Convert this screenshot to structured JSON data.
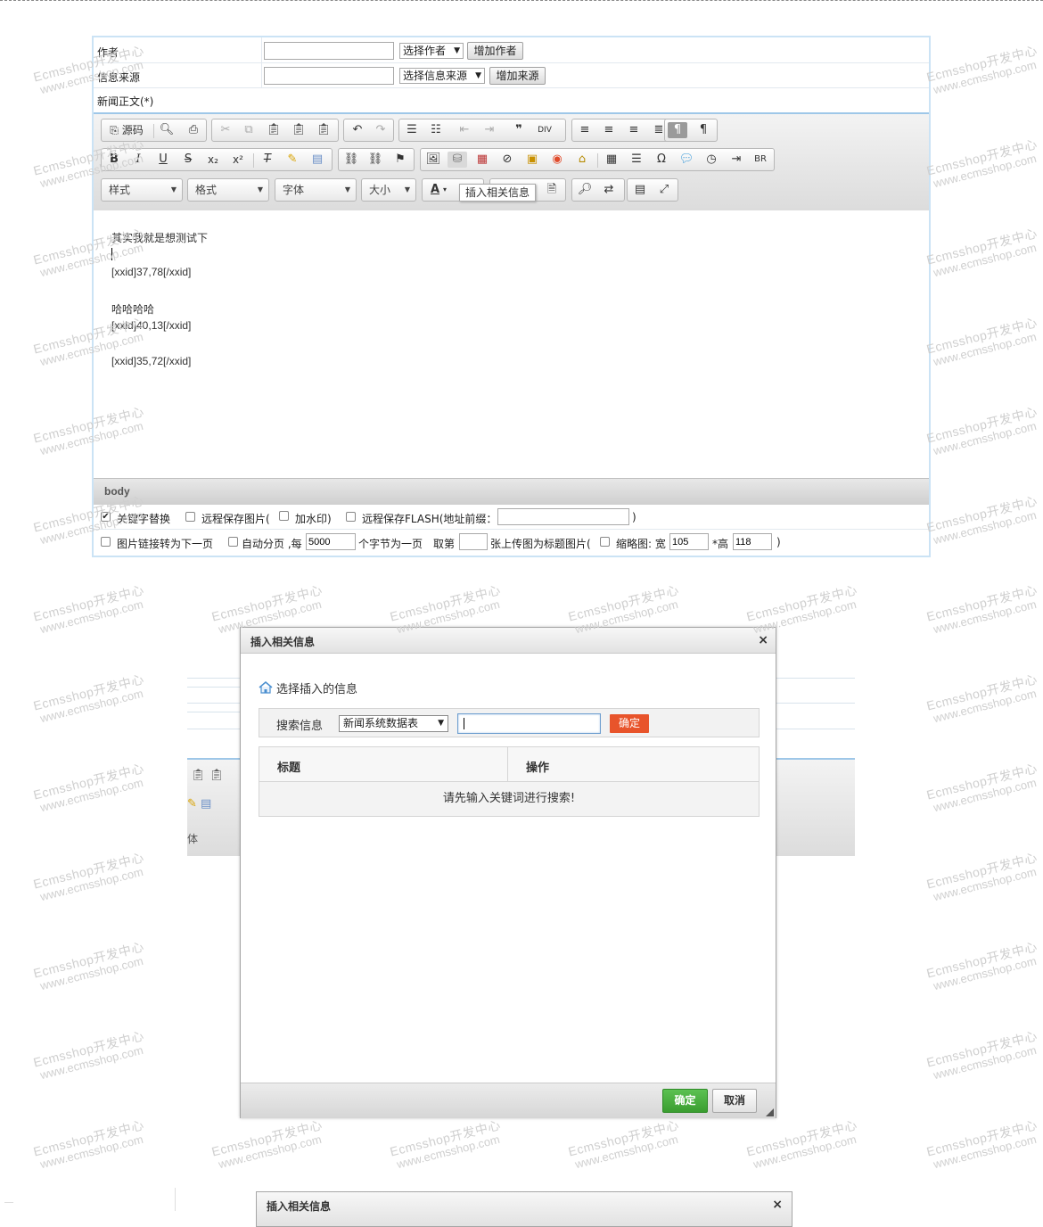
{
  "form": {
    "author_label": "作者",
    "author_value": "",
    "author_select": "选择作者",
    "author_add": "增加作者",
    "source_label": "信息来源",
    "source_value": "",
    "source_select": "选择信息来源",
    "source_add": "增加来源",
    "body_label": "新闻正文(*)"
  },
  "toolbar": {
    "source_btn": "源码",
    "style_combo": "样式",
    "format_combo": "格式",
    "font_combo": "字体",
    "size_combo": "大小",
    "tooltip": "插入相关信息"
  },
  "editor": {
    "lines": [
      "其实我就是想测试下",
      "[xxid]37,78[/xxid]",
      "哈哈哈哈",
      "[xxid]40,13[/xxid]",
      "[xxid]35,72[/xxid]"
    ],
    "path": "body"
  },
  "options": {
    "keyword_replace": "关键字替换",
    "keyword_replace_checked": true,
    "remote_save_img": "远程保存图片(",
    "watermark": "加水印)",
    "remote_save_flash": "远程保存FLASH(地址前缀：",
    "flash_prefix": "",
    "close_paren": ")",
    "img_link_next": "图片链接转为下一页",
    "auto_page": "自动分页 ,每",
    "auto_page_bytes": "5000",
    "bytes_per_page": "个字节为一页",
    "take_nth": "取第",
    "take_nth_value": "",
    "as_title_img": "张上传图为标题图片(",
    "thumb": "缩略图: 宽",
    "thumb_w": "105",
    "thumb_h_label": "*高",
    "thumb_h": "118",
    "thumb_close": ")"
  },
  "dialog": {
    "title": "插入相关信息",
    "section": "选择插入的信息",
    "search_label": "搜索信息",
    "search_table": "新闻系统数据表",
    "search_value": "",
    "search_btn": "确定",
    "col_title": "标题",
    "col_action": "操作",
    "empty_msg": "请先输入关键词进行搜索!",
    "ok": "确定",
    "cancel": "取消",
    "close": "×"
  },
  "dialog2": {
    "title": "插入相关信息",
    "close": "×"
  },
  "ghost": {
    "font_fragment": "体"
  },
  "watermark": {
    "line1": "Ecmsshop开发中心",
    "line2": "www.ecmsshop.com"
  },
  "colors": {
    "accent_blue": "#9ec7e8",
    "ok_green": "#3a9d30",
    "search_btn": "#e8542b"
  }
}
